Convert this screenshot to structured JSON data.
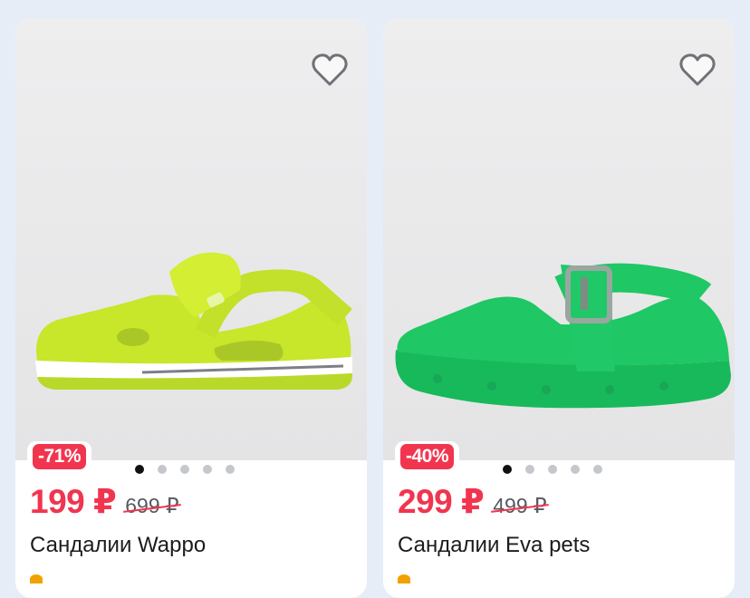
{
  "products": [
    {
      "name": "Сандалии Wappo",
      "discount": "-71%",
      "price": "199 ₽",
      "old_price": "699 ₽",
      "carousel_dots": 5,
      "active_dot": 0,
      "color": "#c8e62a",
      "favorite_icon": "heart-outline-icon"
    },
    {
      "name": "Сандалии Eva pets",
      "discount": "-40%",
      "price": "299 ₽",
      "old_price": "499 ₽",
      "carousel_dots": 5,
      "active_dot": 0,
      "color": "#1fc765",
      "favorite_icon": "heart-outline-icon"
    }
  ],
  "colors": {
    "accent": "#f1354f",
    "background": "#e6edf7"
  }
}
